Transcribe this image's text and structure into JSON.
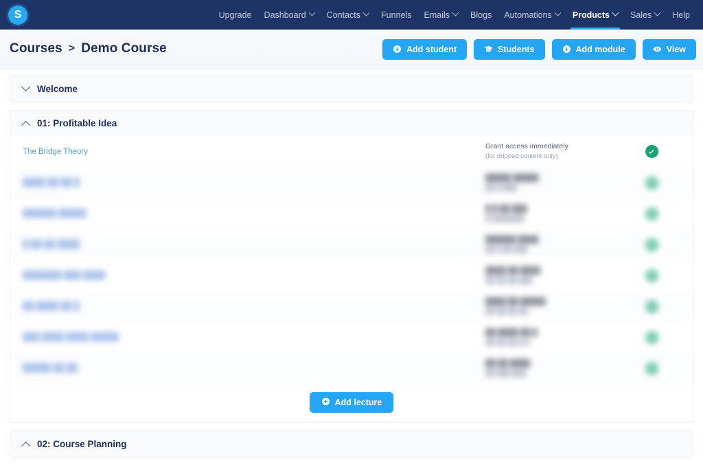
{
  "brand": {
    "logo_letter": "S",
    "accent": "#24a6f5",
    "navbar_bg": "#1e3466",
    "success": "#17a673"
  },
  "topnav": {
    "items": [
      {
        "label": "Upgrade",
        "caret": false,
        "active": false
      },
      {
        "label": "Dashboard",
        "caret": true,
        "active": false
      },
      {
        "label": "Contacts",
        "caret": true,
        "active": false
      },
      {
        "label": "Funnels",
        "caret": false,
        "active": false
      },
      {
        "label": "Emails",
        "caret": true,
        "active": false
      },
      {
        "label": "Blogs",
        "caret": false,
        "active": false
      },
      {
        "label": "Automations",
        "caret": true,
        "active": false
      },
      {
        "label": "Products",
        "caret": true,
        "active": true
      },
      {
        "label": "Sales",
        "caret": true,
        "active": false
      },
      {
        "label": "Help",
        "caret": false,
        "active": false
      }
    ]
  },
  "page_header": {
    "breadcrumb": {
      "parent": "Courses",
      "separator": ">",
      "current": "Demo Course"
    },
    "actions": [
      {
        "label": "Add student",
        "icon": "plus-circle-icon"
      },
      {
        "label": "Students",
        "icon": "graduation-cap-icon"
      },
      {
        "label": "Add module",
        "icon": "plus-circle-icon"
      },
      {
        "label": "View",
        "icon": "eye-icon"
      }
    ]
  },
  "modules": [
    {
      "title": "Welcome",
      "collapsed": true,
      "chevron": "chevron-down-icon",
      "lectures": []
    },
    {
      "title": "01: Profitable Idea",
      "collapsed": false,
      "chevron": "chevron-up-icon",
      "drip_header": {
        "line1": "Grant access immediately",
        "line2": "(for dripped content only)"
      },
      "add_lecture_label": "Add lecture",
      "add_lecture_icon": "plus-circle-icon",
      "lectures": [
        {
          "title": "The Bridge Theory",
          "drip": "Grant access immediately",
          "drip_sub": "(for dripped content only)",
          "granted": true,
          "redacted": false
        },
        {
          "title": "████ ██ ██ █",
          "drip": "█████ █████",
          "drip_sub": "██ █ ███",
          "granted": true,
          "redacted": true
        },
        {
          "title": "██████ █████",
          "drip": "█ █ ██ ███",
          "drip_sub": "█ ███████",
          "granted": true,
          "redacted": true
        },
        {
          "title": "█ ██ ██ ████",
          "drip": "██████ ████",
          "drip_sub": "██ █ ██ ███",
          "granted": true,
          "redacted": true
        },
        {
          "title": "███████ ███ ████",
          "drip": "████ ██ ████",
          "drip_sub": "██ ██ ██ ███",
          "granted": true,
          "redacted": true
        },
        {
          "title": "██ ████ ██ █",
          "drip": "████ ██ █████",
          "drip_sub": "██ ██ ██ ██",
          "granted": true,
          "redacted": true
        },
        {
          "title": "███ ████ ████ █████",
          "drip": "██ ████  ██ █",
          "drip_sub": "██ ██ ██ █ █",
          "granted": true,
          "redacted": true
        },
        {
          "title": "█████ ██ ██",
          "drip": "██ ██ ████",
          "drip_sub": "██ ███ ███",
          "granted": true,
          "redacted": true
        }
      ]
    },
    {
      "title": "02: Course Planning",
      "collapsed": false,
      "chevron": "chevron-up-icon",
      "lectures": []
    }
  ]
}
